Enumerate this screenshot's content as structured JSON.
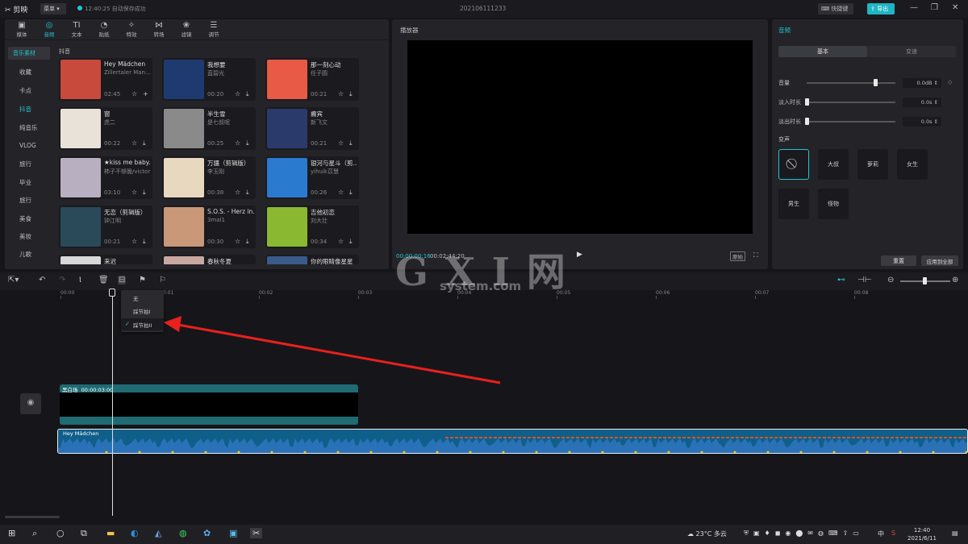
{
  "titlebar": {
    "app_name": "剪映",
    "menu_label": "菜单",
    "autosave": "12:40:25 自动保存成功",
    "project_title": "202106111233",
    "shortcut_label": "快捷键",
    "export_label": "导出"
  },
  "top_tabs": [
    {
      "label": "媒体",
      "icon": "media-icon",
      "glyph": "▣"
    },
    {
      "label": "音频",
      "icon": "audio-icon",
      "glyph": "◎"
    },
    {
      "label": "文本",
      "icon": "text-icon",
      "glyph": "TI"
    },
    {
      "label": "贴纸",
      "icon": "sticker-icon",
      "glyph": "◔"
    },
    {
      "label": "特效",
      "icon": "effects-icon",
      "glyph": "✧"
    },
    {
      "label": "转场",
      "icon": "transition-icon",
      "glyph": "⋈"
    },
    {
      "label": "滤镜",
      "icon": "filter-icon",
      "glyph": "❀"
    },
    {
      "label": "调节",
      "icon": "adjust-icon",
      "glyph": "☰"
    }
  ],
  "sidebar": {
    "items": [
      "音乐素材",
      "收藏",
      "卡点",
      "抖音",
      "纯音乐",
      "VLOG",
      "旅行",
      "毕业",
      "旅行",
      "美食",
      "美妆",
      "儿歌"
    ]
  },
  "section_label": "抖音",
  "music_cards": [
    {
      "title": "Hey Mädchen",
      "artist": "Zillertaler Man...",
      "duration": "02:45",
      "cover": "#c84a3c"
    },
    {
      "title": "我想要",
      "artist": "蓝碧光",
      "duration": "00:20",
      "cover": "#1e3a6e"
    },
    {
      "title": "那一刻心动",
      "artist": "任子圆",
      "duration": "00:21",
      "cover": "#e85a45"
    },
    {
      "title": "窗",
      "artist": "虎二",
      "duration": "00:22",
      "cover": "#e8e2d8"
    },
    {
      "title": "半生雪",
      "artist": "是七叔呢",
      "duration": "00:25",
      "cover": "#8a8a8a"
    },
    {
      "title": "癫宾",
      "artist": "新飞文",
      "duration": "00:21",
      "cover": "#2a3a6a"
    },
    {
      "title": "★kiss me baby...",
      "artist": "柿子不够脆/victor",
      "duration": "03:10",
      "cover": "#b8b0c0"
    },
    {
      "title": "万疆（剪辑版）",
      "artist": "李玉刚",
      "duration": "00:38",
      "cover": "#e8d8c0"
    },
    {
      "title": "银河与星斗（剪...",
      "artist": "yihuik苡慧",
      "duration": "00:26",
      "cover": "#2a7ad0"
    },
    {
      "title": "无恋（剪辑版）",
      "artist": "钟江明",
      "duration": "00:21",
      "cover": "#2a4a5a"
    },
    {
      "title": "S.O.S. - Herz in...",
      "artist": "3mal1",
      "duration": "00:30",
      "cover": "#c89878"
    },
    {
      "title": "吉他初恋",
      "artist": "刘大壮",
      "duration": "00:34",
      "cover": "#8ab830"
    },
    {
      "title": "来迟",
      "artist": "",
      "duration": "",
      "cover": "#d8d8d8"
    },
    {
      "title": "春秋冬夏",
      "artist": "",
      "duration": "",
      "cover": "#c8a8a0"
    },
    {
      "title": "你的眼睛像星星",
      "artist": "",
      "duration": "",
      "cover": "#3a5a8a"
    }
  ],
  "player": {
    "title": "播放器",
    "current_time": "00:00:00:16",
    "total_time": "00:02:44:20",
    "ratio_label": "原始"
  },
  "audio_panel": {
    "title": "音频",
    "tabs": [
      "基本",
      "变速"
    ],
    "volume_label": "音量",
    "volume_value": "0.0dB",
    "volume_level_pct": 75,
    "fade_in_label": "淡入时长",
    "fade_in_value": "0.0s",
    "fade_out_label": "淡出时长",
    "fade_out_value": "0.0s",
    "voice_label": "变声",
    "voices": [
      "大叔",
      "萝莉",
      "女生",
      "男生",
      "怪物"
    ],
    "reset_label": "重置",
    "apply_all_label": "应用到全部"
  },
  "ruler_ticks": [
    "00:00",
    "00:01",
    "00:02",
    "00:03",
    "00:04",
    "00:05",
    "00:06",
    "00:07",
    "00:08"
  ],
  "beat_menu": {
    "items": [
      "无",
      "踩节拍I",
      "踩节拍II"
    ],
    "selected": "踩节拍II"
  },
  "tracks": {
    "video_label": "黑白场",
    "video_duration": "00:00:03:00",
    "audio_label": "Hey Mädchen"
  },
  "watermark": {
    "main": "G X I 网",
    "sub": "system.com"
  },
  "taskbar": {
    "weather": "23°C 多云",
    "ime": "中",
    "time": "12:40",
    "date": "2021/6/11"
  },
  "colors": {
    "accent": "#22c4d2",
    "annotation_arrow": "#e8201e",
    "waveform": "#2a72b8",
    "beat_marker": "#f2c200"
  }
}
